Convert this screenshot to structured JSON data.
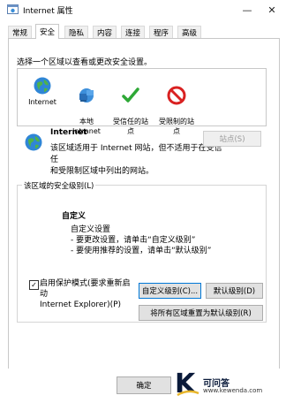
{
  "window": {
    "title": "Internet 属性",
    "minimize": "—",
    "close": "✕"
  },
  "tabs": [
    "常规",
    "安全",
    "隐私",
    "内容",
    "连接",
    "程序",
    "高级"
  ],
  "active_tab": "安全",
  "zone_prompt": "选择一个区域以查看或更改安全设置。",
  "zones": [
    {
      "label": "Internet",
      "icon": "globe-icon"
    },
    {
      "label": "本地\nIntranet",
      "icon": "intranet-icon"
    },
    {
      "label": "受信任的站\n点",
      "icon": "checkmark-icon"
    },
    {
      "label": "受限制的站\n点",
      "icon": "restricted-icon"
    }
  ],
  "selected_zone": {
    "name": "Internet",
    "description": "该区域适用于 Internet 网站，但不适用于在受信任\n和受限制区域中列出的网站。",
    "sites_button": "站点(S)"
  },
  "security_level": {
    "group_label": "该区域的安全级别(L)",
    "level_name": "自定义",
    "lines": [
      "自定义设置",
      "- 要更改设置，请单击“自定义级别”",
      "- 要使用推荐的设置，请单击“默认级别”"
    ],
    "protected_mode": "启用保护模式(要求重新启动\nInternet Explorer)(P)",
    "protected_mode_checked": true,
    "custom_button": "自定义级别(C)...",
    "default_button": "默认级别(D)",
    "reset_all_button": "将所有区域重置为默认级别(R)"
  },
  "footer": {
    "ok_button": "确定"
  },
  "watermark": {
    "letter": "K",
    "line1": "可问答",
    "line2": "www.kewenda.com"
  },
  "colors": {
    "accent": "#e8b62c",
    "watermark_letter": "#0a1a3a"
  }
}
